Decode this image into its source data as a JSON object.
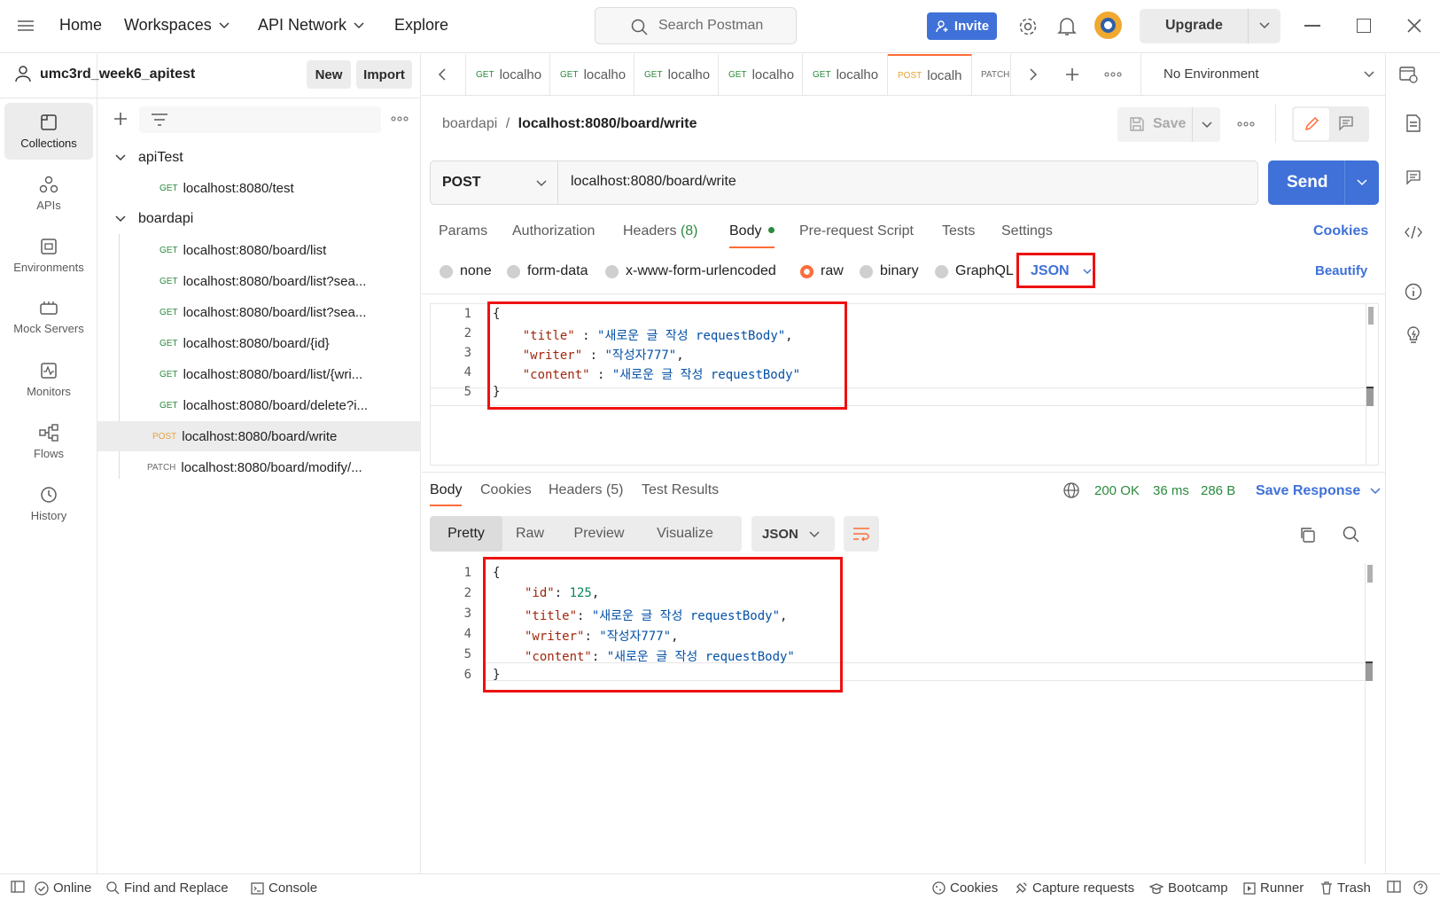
{
  "topbar": {
    "home": "Home",
    "workspaces": "Workspaces",
    "api_network": "API Network",
    "explore": "Explore",
    "search_placeholder": "Search Postman",
    "invite": "Invite",
    "upgrade": "Upgrade"
  },
  "workspace": {
    "name": "umc3rd_week6_apitest",
    "new_label": "New",
    "import_label": "Import"
  },
  "rail": [
    {
      "label": "Collections",
      "icon": "collections-icon"
    },
    {
      "label": "APIs",
      "icon": "apis-icon"
    },
    {
      "label": "Environments",
      "icon": "environments-icon"
    },
    {
      "label": "Mock Servers",
      "icon": "mock-servers-icon"
    },
    {
      "label": "Monitors",
      "icon": "monitors-icon"
    },
    {
      "label": "Flows",
      "icon": "flows-icon"
    },
    {
      "label": "History",
      "icon": "history-icon"
    }
  ],
  "tree": {
    "folders": [
      {
        "name": "apiTest",
        "requests": [
          {
            "method": "GET",
            "url": "localhost:8080/test"
          }
        ]
      },
      {
        "name": "boardapi",
        "requests": [
          {
            "method": "GET",
            "url": "localhost:8080/board/list"
          },
          {
            "method": "GET",
            "url": "localhost:8080/board/list?sea..."
          },
          {
            "method": "GET",
            "url": "localhost:8080/board/list?sea..."
          },
          {
            "method": "GET",
            "url": "localhost:8080/board/{id}"
          },
          {
            "method": "GET",
            "url": "localhost:8080/board/list/{wri..."
          },
          {
            "method": "GET",
            "url": "localhost:8080/board/delete?i..."
          },
          {
            "method": "POST",
            "url": "localhost:8080/board/write"
          },
          {
            "method": "PATCH",
            "url": "localhost:8080/board/modify/..."
          }
        ]
      }
    ]
  },
  "tabs": [
    {
      "method": "GET",
      "label": "localho"
    },
    {
      "method": "GET",
      "label": "localho"
    },
    {
      "method": "GET",
      "label": "localho"
    },
    {
      "method": "GET",
      "label": "localho"
    },
    {
      "method": "GET",
      "label": "localho"
    },
    {
      "method": "POST",
      "label": "localh"
    },
    {
      "method": "PATCH",
      "label": ""
    }
  ],
  "environment": "No Environment",
  "request": {
    "breadcrumb_parent": "boardapi",
    "breadcrumb_sep": "/",
    "breadcrumb_current": "localhost:8080/board/write",
    "save_label": "Save",
    "method": "POST",
    "url": "localhost:8080/board/write",
    "send_label": "Send",
    "subtabs": {
      "params": "Params",
      "authorization": "Authorization",
      "headers": "Headers",
      "headers_count": "(8)",
      "body": "Body",
      "prerequest": "Pre-request Script",
      "tests": "Tests",
      "settings": "Settings",
      "cookies": "Cookies"
    },
    "body_types": [
      "none",
      "form-data",
      "x-www-form-urlencoded",
      "raw",
      "binary",
      "GraphQL"
    ],
    "body_format": "JSON",
    "beautify": "Beautify",
    "body_lines": [
      [
        "{",
        "",
        "",
        "",
        ""
      ],
      [
        "    ",
        "\"title\"",
        " : ",
        "\"새로운 글 작성 requestBody\"",
        ","
      ],
      [
        "    ",
        "\"writer\"",
        " : ",
        "\"작성자777\"",
        ","
      ],
      [
        "    ",
        "\"content\"",
        " : ",
        "\"새로운 글 작성 requestBody\"",
        ""
      ],
      [
        "}",
        "",
        "",
        "",
        ""
      ]
    ]
  },
  "response": {
    "tabs": {
      "body": "Body",
      "cookies": "Cookies",
      "headers": "Headers",
      "headers_count": "(5)",
      "tests": "Test Results"
    },
    "status": "200 OK",
    "time": "36 ms",
    "size": "286 B",
    "save_response": "Save Response",
    "views": [
      "Pretty",
      "Raw",
      "Preview",
      "Visualize"
    ],
    "format": "JSON",
    "lines": [
      {
        "text": "{"
      },
      {
        "key": "\"id\"",
        "num": "125"
      },
      {
        "key": "\"title\"",
        "str": "\"새로운 글 작성 requestBody\""
      },
      {
        "key": "\"writer\"",
        "str": "\"작성자777\""
      },
      {
        "key": "\"content\"",
        "str": "\"새로운 글 작성 requestBody\""
      },
      {
        "text": "}"
      }
    ]
  },
  "statusbar": {
    "online": "Online",
    "find_replace": "Find and Replace",
    "console": "Console",
    "cookies": "Cookies",
    "capture": "Capture requests",
    "bootcamp": "Bootcamp",
    "runner": "Runner",
    "trash": "Trash"
  },
  "colors": {
    "accent": "#ff6c37",
    "primary": "#3f71d8",
    "get": "#2b8a3e",
    "post": "#e8a33a",
    "highlight": "#ee1111"
  }
}
